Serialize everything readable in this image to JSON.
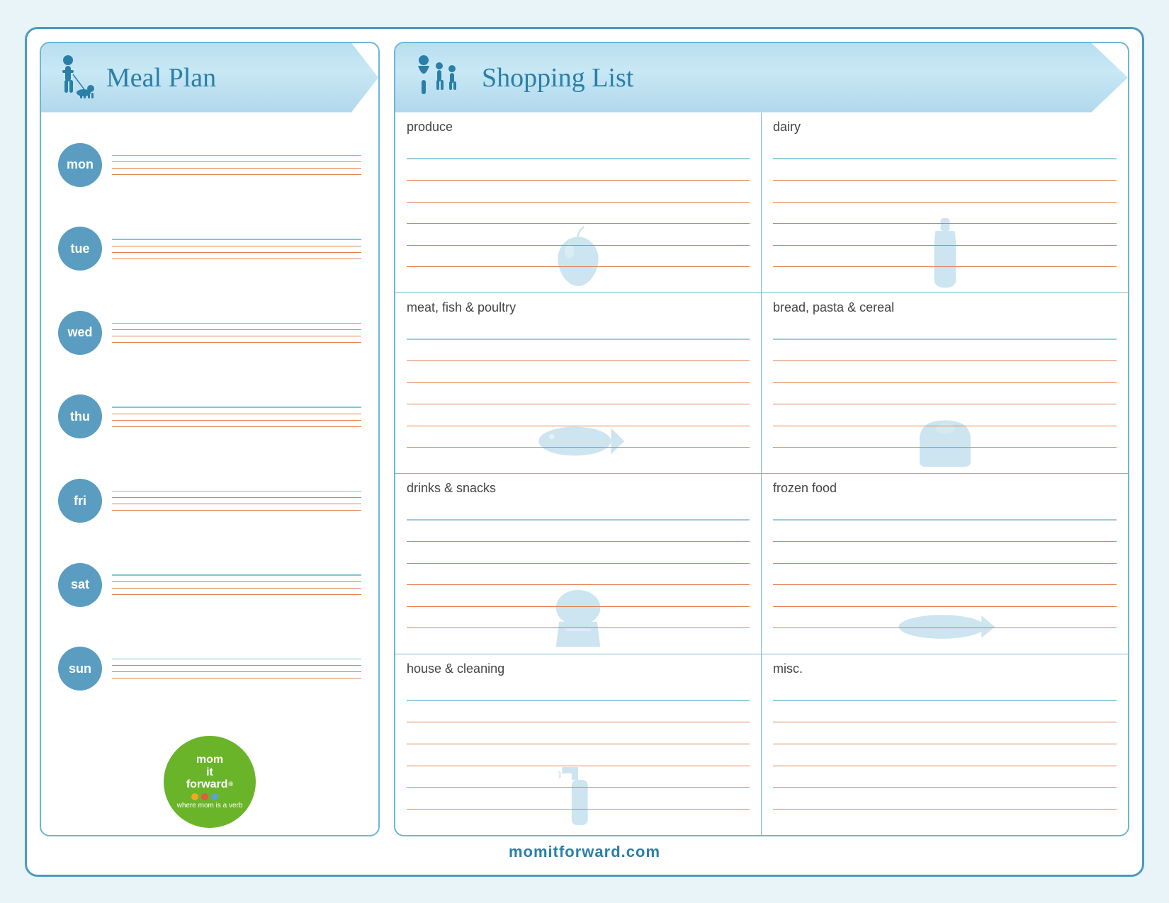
{
  "page": {
    "background_color": "#e8f4f8",
    "border_color": "#4a9bbf"
  },
  "meal_plan": {
    "title": "Meal Plan",
    "days": [
      {
        "label": "mon",
        "id": "monday"
      },
      {
        "label": "tue",
        "id": "tuesday"
      },
      {
        "label": "wed",
        "id": "wednesday"
      },
      {
        "label": "thu",
        "id": "thursday"
      },
      {
        "label": "fri",
        "id": "friday"
      },
      {
        "label": "sat",
        "id": "saturday"
      },
      {
        "label": "sun",
        "id": "sunday"
      }
    ]
  },
  "shopping_list": {
    "title": "Shopping List",
    "sections": [
      {
        "id": "produce",
        "label": "produce",
        "icon": "apple"
      },
      {
        "id": "dairy",
        "label": "dairy",
        "icon": "bottle"
      },
      {
        "id": "meat",
        "label": "meat, fish & poultry",
        "icon": "fish"
      },
      {
        "id": "bread",
        "label": "bread, pasta & cereal",
        "icon": "bread"
      },
      {
        "id": "drinks",
        "label": "drinks & snacks",
        "icon": "cup"
      },
      {
        "id": "frozen",
        "label": "frozen food",
        "icon": "fish2"
      },
      {
        "id": "house",
        "label": "house & cleaning",
        "icon": "spray"
      },
      {
        "id": "misc",
        "label": "misc.",
        "icon": "none"
      }
    ]
  },
  "footer": {
    "text": "momitforward.com"
  },
  "logo": {
    "line1": "mom",
    "line2": "it",
    "line3": "forward",
    "tagline": "where mom is a verb",
    "trademark": "®",
    "dot_colors": [
      "#f5a623",
      "#e05c3a",
      "#5ba3d0",
      "#6ab42a"
    ]
  }
}
